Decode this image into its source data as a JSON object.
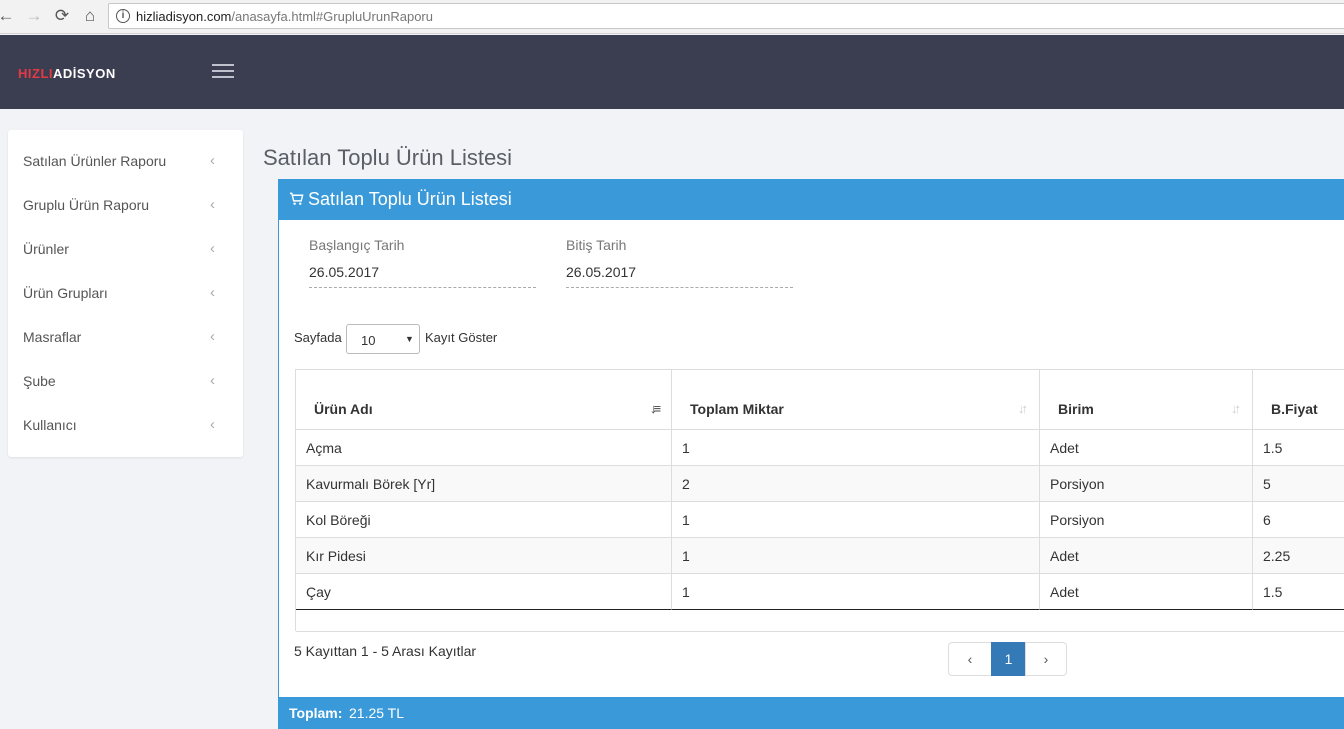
{
  "browser": {
    "back_glyph": "←",
    "forward_glyph": "→",
    "reload_glyph": "⟳",
    "home_glyph": "⌂",
    "info_glyph": "i",
    "url_host": "hizliadisyon.com",
    "url_path": "/anasayfa.html#GrupluUrunRaporu"
  },
  "header": {
    "logo_red": "HIZLI",
    "logo_white": "ADİSYON"
  },
  "sidebar": {
    "chevron": "‹",
    "items": [
      {
        "label": "Satılan Ürünler Raporu"
      },
      {
        "label": "Gruplu Ürün Raporu"
      },
      {
        "label": "Ürünler"
      },
      {
        "label": "Ürün Grupları"
      },
      {
        "label": "Masraflar"
      },
      {
        "label": "Şube"
      },
      {
        "label": "Kullanıcı"
      }
    ]
  },
  "main": {
    "page_title": "Satılan Toplu Ürün Listesi",
    "panel_title": "Satılan Toplu Ürün Listesi",
    "start_label": "Başlangıç Tarih",
    "start_value": "26.05.2017",
    "end_label": "Bitiş Tarih",
    "end_value": "26.05.2017",
    "length_prefix": "Sayfada",
    "length_value": "10",
    "length_arrow": "▼",
    "length_suffix": "Kayıt Göster"
  },
  "table": {
    "columns": [
      {
        "label": "Ürün Adı"
      },
      {
        "label": "Toplam Miktar"
      },
      {
        "label": "Birim"
      },
      {
        "label": "B.Fiyat"
      }
    ],
    "sort_icon": "↓≡",
    "sort_idle_icon": "↓↑",
    "rows": [
      [
        "Açma",
        "1",
        "Adet",
        "1.5"
      ],
      [
        "Kavurmalı Börek [Yr]",
        "2",
        "Porsiyon",
        "5"
      ],
      [
        "Kol Böreği",
        "1",
        "Porsiyon",
        "6"
      ],
      [
        "Kır Pidesi",
        "1",
        "Adet",
        "2.25"
      ],
      [
        "Çay",
        "1",
        "Adet",
        "1.5"
      ]
    ]
  },
  "footer": {
    "info": "5 Kayıttan 1 - 5 Arası Kayıtlar",
    "prev": "‹",
    "page": "1",
    "next": "›",
    "total_label": "Toplam:",
    "total_value": "21.25 TL"
  },
  "colors": {
    "header_bg": "#3b3d50",
    "accent": "#3a9ad9",
    "logo_red": "#e53945",
    "pager_active": "#337ab7"
  }
}
